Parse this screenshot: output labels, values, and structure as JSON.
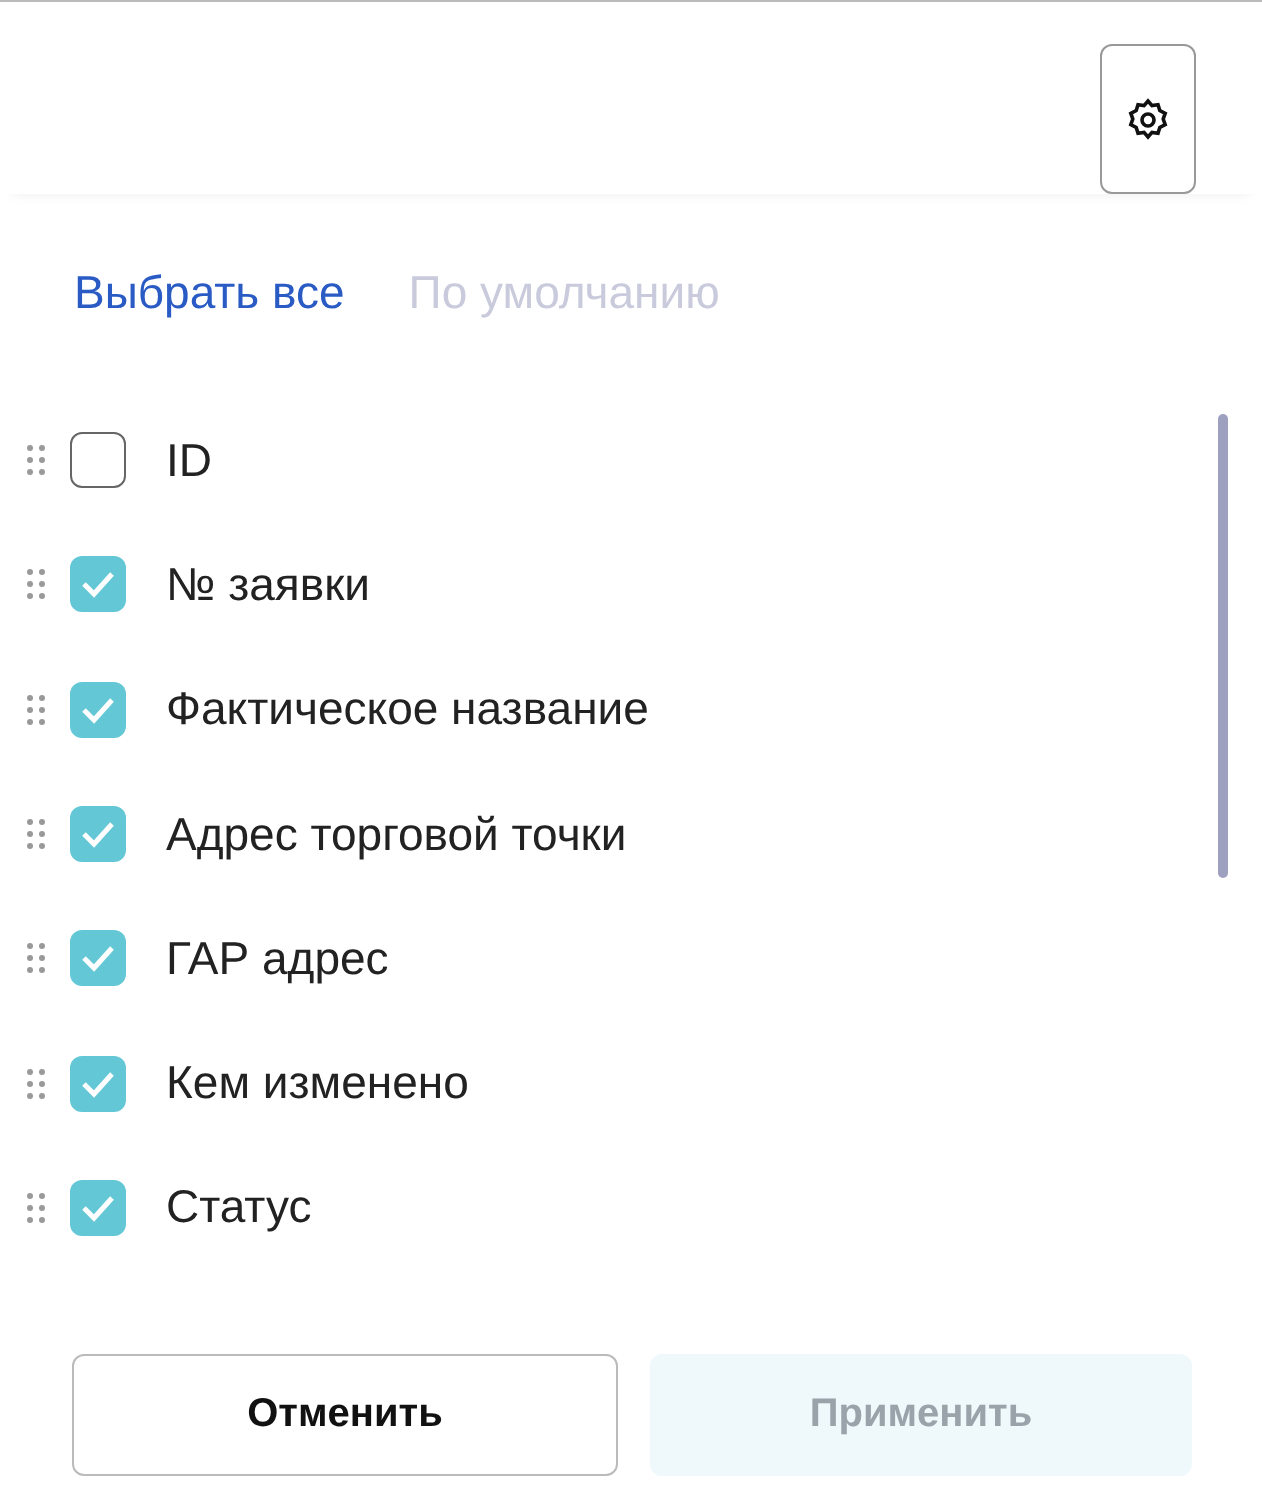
{
  "links": [
    {
      "label": "Выбрать все",
      "disabled": false
    },
    {
      "label": "По умолчанию",
      "disabled": true
    }
  ],
  "columns": [
    {
      "label": "ID",
      "checked": false
    },
    {
      "label": "№ заявки",
      "checked": true
    },
    {
      "label": "Фактическое название",
      "checked": true
    },
    {
      "label": "Адрес торговой точки",
      "checked": true
    },
    {
      "label": "ГАР адрес",
      "checked": true
    },
    {
      "label": "Кем изменено",
      "checked": true
    },
    {
      "label": "Статус",
      "checked": true
    }
  ],
  "buttons": [
    {
      "label": "Отменить",
      "kind": "secondary",
      "disabled": false
    },
    {
      "label": "Применить",
      "kind": "primary",
      "disabled": true
    }
  ]
}
